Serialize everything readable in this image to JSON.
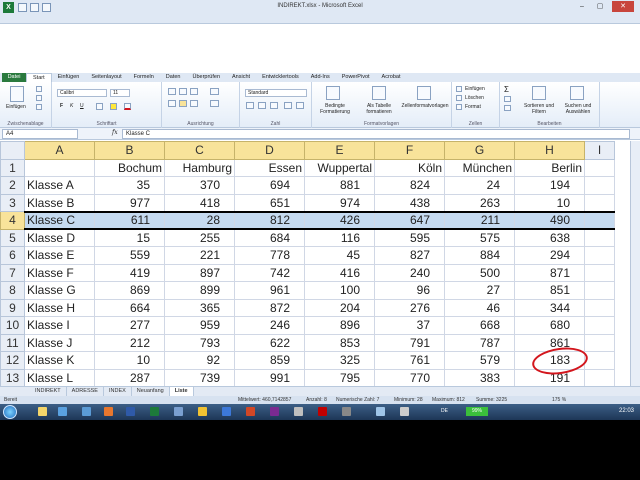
{
  "window": {
    "title": "INDIREKT.xlsx - Microsoft Excel",
    "minimize": "–",
    "restore": "▢",
    "close": "✕"
  },
  "ribbon": {
    "tabs": [
      "Datei",
      "Start",
      "Einfügen",
      "Seitenlayout",
      "Formeln",
      "Daten",
      "Überprüfen",
      "Ansicht",
      "Entwicklertools",
      "Add-Ins",
      "PowerPivot",
      "Acrobat"
    ],
    "active_tab": "Start",
    "clipboard": {
      "paste": "Einfügen",
      "group": "Zwischenablage"
    },
    "font": {
      "name": "Calibri",
      "size": "11",
      "bold": "F",
      "italic": "K",
      "underline": "U",
      "group": "Schriftart"
    },
    "alignment": {
      "group": "Ausrichtung"
    },
    "number": {
      "format": "Standard",
      "group": "Zahl"
    },
    "styles": {
      "conditional": "Bedingte Formatierung",
      "as_table": "Als Tabelle formatieren",
      "cell_styles": "Zellenformatvorlagen",
      "group": "Formatvorlagen"
    },
    "cells": {
      "insert": "Einfügen",
      "delete": "Löschen",
      "format": "Format",
      "group": "Zellen"
    },
    "editing": {
      "sigma": "Σ",
      "sort": "Sortieren und Filtern",
      "find": "Suchen und Auswählen",
      "group": "Bearbeiten"
    }
  },
  "formula_bar": {
    "name_box": "A4",
    "fx": "fx",
    "content": "Klasse C"
  },
  "sheet": {
    "columns": [
      "A",
      "B",
      "C",
      "D",
      "E",
      "F",
      "G",
      "H",
      "I"
    ],
    "header_row": {
      "row": "1",
      "cells": [
        "",
        "Bochum",
        "Hamburg",
        "Essen",
        "Wuppertal",
        "Köln",
        "München",
        "Berlin",
        ""
      ]
    },
    "rows": [
      {
        "row": "2",
        "label": "Klasse A",
        "values": [
          "35",
          "370",
          "694",
          "881",
          "824",
          "24",
          "194"
        ]
      },
      {
        "row": "3",
        "label": "Klasse B",
        "values": [
          "977",
          "418",
          "651",
          "974",
          "438",
          "263",
          "10"
        ]
      },
      {
        "row": "4",
        "label": "Klasse C",
        "values": [
          "611",
          "28",
          "812",
          "426",
          "647",
          "211",
          "490"
        ]
      },
      {
        "row": "5",
        "label": "Klasse D",
        "values": [
          "15",
          "255",
          "684",
          "116",
          "595",
          "575",
          "638"
        ]
      },
      {
        "row": "6",
        "label": "Klasse E",
        "values": [
          "559",
          "221",
          "778",
          "45",
          "827",
          "884",
          "294"
        ]
      },
      {
        "row": "7",
        "label": "Klasse F",
        "values": [
          "419",
          "897",
          "742",
          "416",
          "240",
          "500",
          "871"
        ]
      },
      {
        "row": "8",
        "label": "Klasse G",
        "values": [
          "869",
          "899",
          "961",
          "100",
          "96",
          "27",
          "851"
        ]
      },
      {
        "row": "9",
        "label": "Klasse H",
        "values": [
          "664",
          "365",
          "872",
          "204",
          "276",
          "46",
          "344"
        ]
      },
      {
        "row": "10",
        "label": "Klasse I",
        "values": [
          "277",
          "959",
          "246",
          "896",
          "37",
          "668",
          "680"
        ]
      },
      {
        "row": "11",
        "label": "Klasse J",
        "values": [
          "212",
          "793",
          "622",
          "853",
          "791",
          "787",
          "861"
        ]
      },
      {
        "row": "12",
        "label": "Klasse K",
        "values": [
          "10",
          "92",
          "859",
          "325",
          "761",
          "579",
          "183"
        ]
      },
      {
        "row": "13",
        "label": "Klasse L",
        "values": [
          "287",
          "739",
          "991",
          "795",
          "770",
          "383",
          "191"
        ]
      }
    ],
    "selected_row": "4"
  },
  "sheet_tabs": [
    "INDIREKT",
    "ADRESSE",
    "INDEX",
    "Neuanfang",
    "Liste"
  ],
  "active_sheet_tab": "Liste",
  "status": {
    "mode": "Bereit",
    "average": "Mittelwert: 460,7142857",
    "count": "Anzahl: 8",
    "numeric_count": "Numerische Zahl: 7",
    "min": "Minimum: 28",
    "max": "Maximum: 812",
    "sum": "Summe: 3225",
    "zoom": "175 %"
  },
  "taskbar": {
    "language": "DE",
    "battery": "99%",
    "clock": "22:03"
  },
  "colors": {
    "selection": "#c5daf0",
    "column_header_active": "#f8e39a",
    "annotation": "#d3161d",
    "file_tab": "#2a7a3e"
  }
}
